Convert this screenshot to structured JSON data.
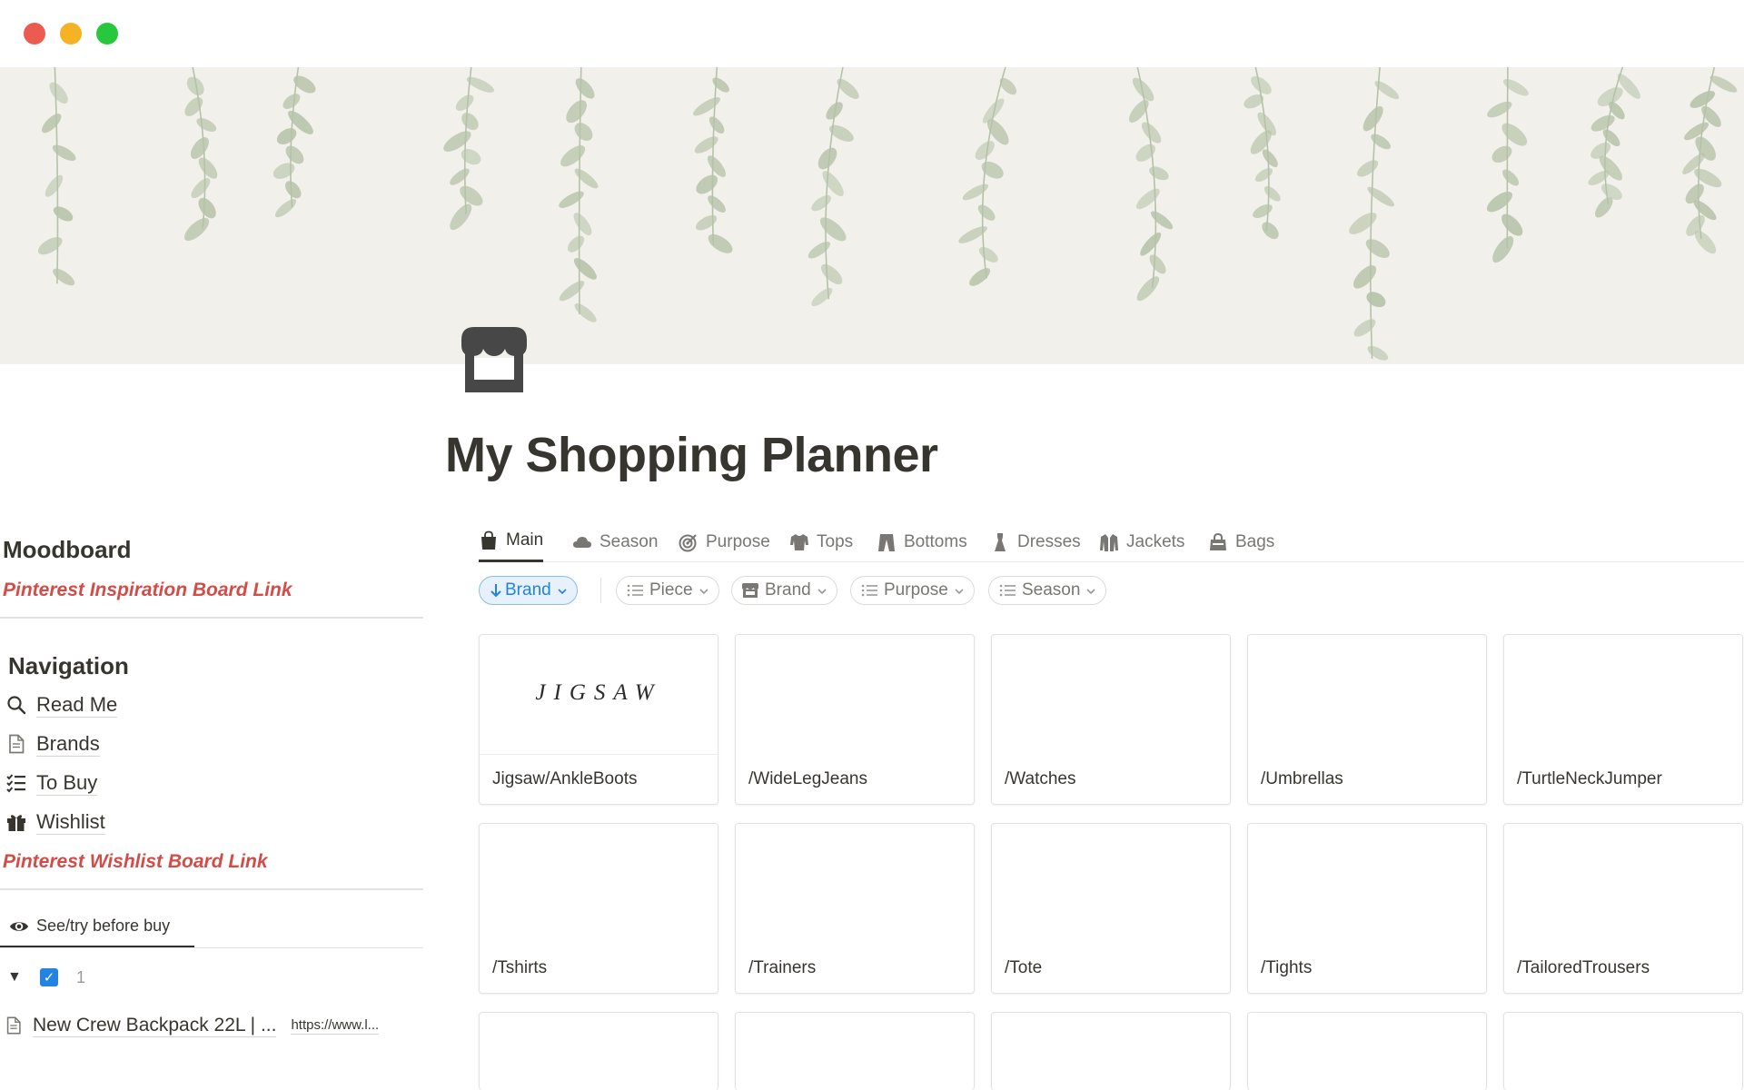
{
  "page": {
    "title": "My Shopping Planner",
    "icon": "storefront-icon",
    "cover": "botanical-leaves-illustration"
  },
  "sidebar": {
    "moodboard_heading": "Moodboard",
    "inspiration_link": "Pinterest Inspiration Board Link",
    "navigation_heading": "Navigation",
    "nav_items": [
      {
        "label": "Read Me",
        "icon": "search-icon"
      },
      {
        "label": "Brands",
        "icon": "document-icon"
      },
      {
        "label": "To Buy",
        "icon": "checklist-icon"
      },
      {
        "label": "Wishlist",
        "icon": "gift-icon"
      }
    ],
    "wishlist_link": "Pinterest Wishlist Board Link",
    "view_tab": {
      "label": "See/try before buy",
      "icon": "eye-icon"
    },
    "group": {
      "checked": true,
      "count": "1"
    },
    "item": {
      "title": "New Crew Backpack 22L | ...",
      "url": "https://www.l..."
    }
  },
  "tabs": [
    {
      "label": "Main",
      "icon": "shopping-bag-icon",
      "active": true
    },
    {
      "label": "Season",
      "icon": "cloud-icon",
      "active": false
    },
    {
      "label": "Purpose",
      "icon": "target-icon",
      "active": false
    },
    {
      "label": "Tops",
      "icon": "shirt-icon",
      "active": false
    },
    {
      "label": "Bottoms",
      "icon": "trousers-icon",
      "active": false
    },
    {
      "label": "Dresses",
      "icon": "dress-icon",
      "active": false
    },
    {
      "label": "Jackets",
      "icon": "jacket-icon",
      "active": false
    },
    {
      "label": "Bags",
      "icon": "bag-icon",
      "active": false
    }
  ],
  "filters": {
    "sort": {
      "label": "Brand",
      "direction": "descending"
    },
    "chips": [
      {
        "label": "Piece",
        "icon": "list-icon"
      },
      {
        "label": "Brand",
        "icon": "storefront-icon"
      },
      {
        "label": "Purpose",
        "icon": "list-icon"
      },
      {
        "label": "Season",
        "icon": "list-icon"
      }
    ]
  },
  "gallery": {
    "cards": [
      {
        "name": "Jigsaw/AnkleBoots",
        "preview_text": "JIGSAW"
      },
      {
        "name": "/WideLegJeans"
      },
      {
        "name": "/Watches"
      },
      {
        "name": "/Umbrellas"
      },
      {
        "name": "/TurtleNeckJumper"
      },
      {
        "name": "/Tshirts"
      },
      {
        "name": "/Trainers"
      },
      {
        "name": "/Tote"
      },
      {
        "name": "/Tights"
      },
      {
        "name": "/TailoredTrousers"
      },
      {
        "name": ""
      },
      {
        "name": ""
      },
      {
        "name": ""
      },
      {
        "name": ""
      },
      {
        "name": ""
      }
    ]
  },
  "colors": {
    "accent_red": "#d44c47",
    "accent_blue": "#2383e2",
    "text": "#37352f",
    "muted": "#787774",
    "cover_bg": "#f1f0ea",
    "leaf": "#b6c2a8"
  }
}
